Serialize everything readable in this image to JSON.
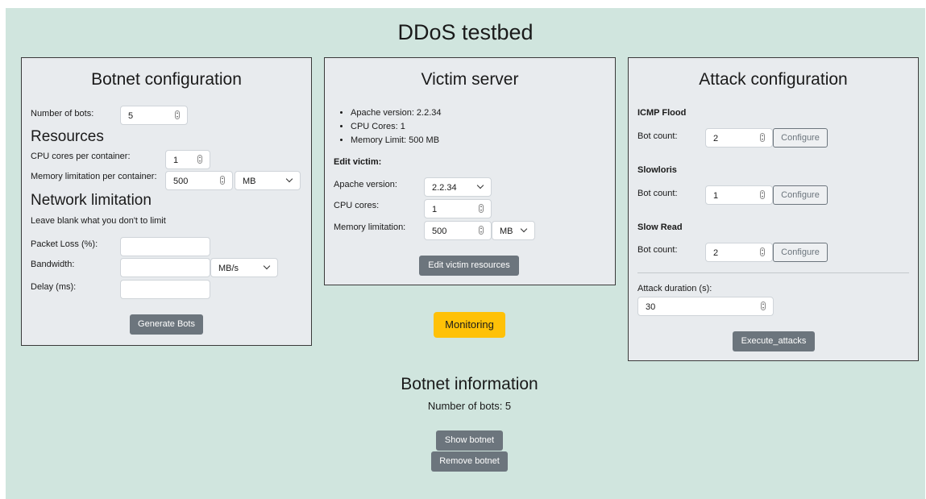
{
  "page_title": "DDoS testbed",
  "botnet_config": {
    "title": "Botnet configuration",
    "num_bots_label": "Number of bots:",
    "num_bots_value": "5",
    "resources_heading": "Resources",
    "cpu_label": "CPU cores per container:",
    "cpu_value": "1",
    "memory_label": "Memory limitation per container:",
    "memory_value": "500",
    "memory_unit": "MB",
    "network_heading": "Network limitation",
    "network_hint": "Leave blank what you don't to limit",
    "packet_loss_label": "Packet Loss (%):",
    "packet_loss_value": "",
    "bandwidth_label": "Bandwidth:",
    "bandwidth_value": "",
    "bandwidth_unit": "MB/s",
    "delay_label": "Delay (ms):",
    "delay_value": "",
    "generate_button": "Generate Bots"
  },
  "victim": {
    "title": "Victim server",
    "info": [
      "Apache version: 2.2.34",
      "CPU Cores: 1",
      "Memory Limit: 500 MB"
    ],
    "edit_heading": "Edit victim:",
    "apache_label": "Apache version:",
    "apache_value": "2.2.34",
    "cpu_label": "CPU cores:",
    "cpu_value": "1",
    "memory_label": "Memory limitation:",
    "memory_value": "500",
    "memory_unit": "MB",
    "edit_button": "Edit victim resources"
  },
  "monitoring_button": "Monitoring",
  "attack_config": {
    "title": "Attack configuration",
    "attacks": [
      {
        "name": "ICMP Flood",
        "bot_count_label": "Bot count:",
        "bot_count": "2",
        "configure": "Configure"
      },
      {
        "name": "Slowloris",
        "bot_count_label": "Bot count:",
        "bot_count": "1",
        "configure": "Configure"
      },
      {
        "name": "Slow Read",
        "bot_count_label": "Bot count:",
        "bot_count": "2",
        "configure": "Configure"
      }
    ],
    "duration_label": "Attack duration (s):",
    "duration_value": "30",
    "execute_button": "Execute_attacks"
  },
  "botnet_info": {
    "title": "Botnet information",
    "num_bots": "Number of bots: 5",
    "show_button": "Show botnet",
    "remove_button": "Remove botnet"
  },
  "colors": {
    "background": "#d0e5de",
    "panel": "#e8ebee",
    "button": "#6c757d",
    "monitoring": "#ffc107"
  }
}
